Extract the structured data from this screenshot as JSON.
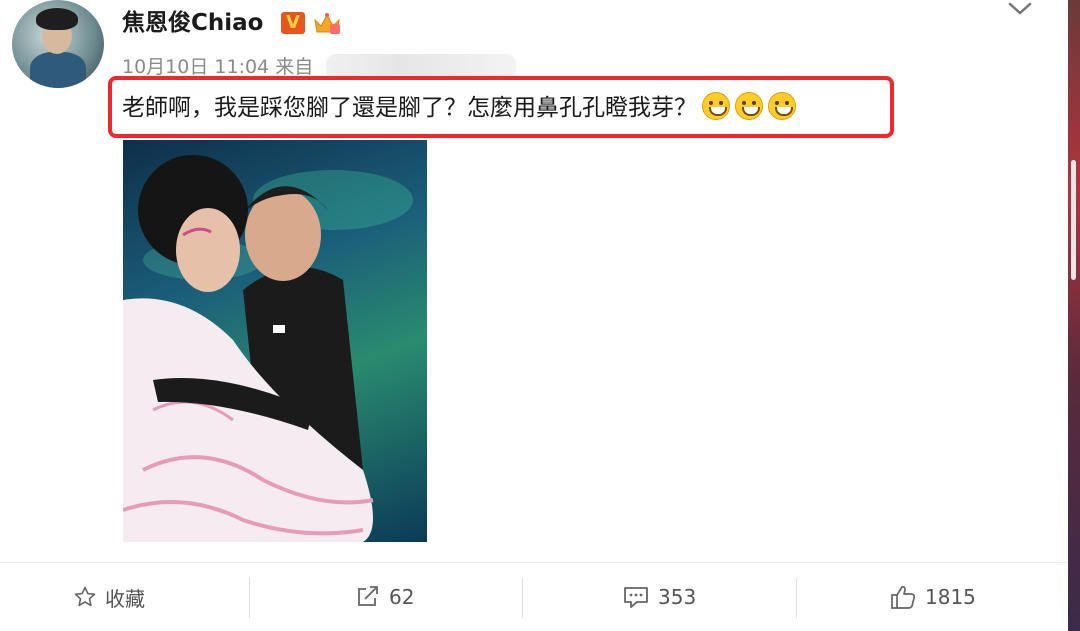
{
  "user": {
    "name": "焦恩俊Chiao",
    "verified_badge": "V"
  },
  "post": {
    "meta": "10月10日 11:04 来自",
    "text": "老師啊，我是踩您腳了還是腳了？怎麼用鼻孔孔瞪我芽？",
    "emojis": [
      "grin-emoji",
      "grin-emoji",
      "grin-emoji"
    ]
  },
  "actions": {
    "favorite": {
      "label": "收藏",
      "icon": "star-icon"
    },
    "repost": {
      "count": "62",
      "icon": "share-icon"
    },
    "comment": {
      "count": "353",
      "icon": "comment-icon"
    },
    "like": {
      "count": "1815",
      "icon": "thumbs-up-icon"
    }
  },
  "colors": {
    "highlight": "#f2272a",
    "verified": "#e8561f",
    "text": "#1a1a1a",
    "muted": "#8a8a8a"
  }
}
